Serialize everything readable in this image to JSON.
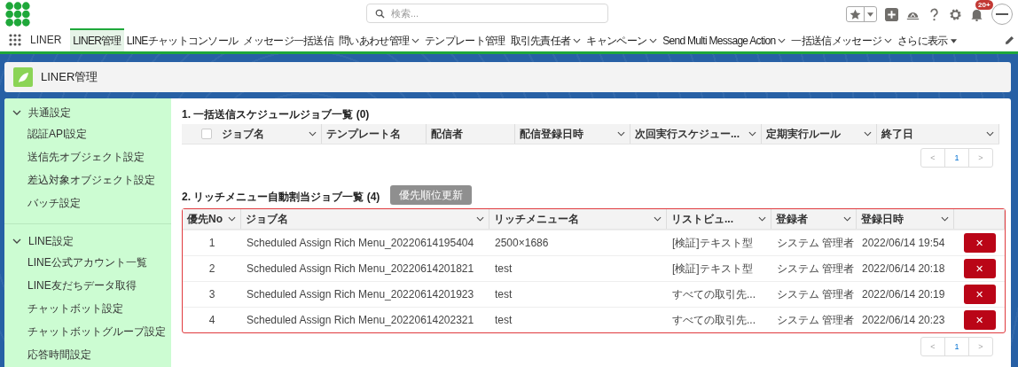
{
  "app": {
    "name": "LINER",
    "search": {
      "placeholder": "検索..."
    },
    "notifications": "20+"
  },
  "nav": [
    {
      "label": "LINER管理",
      "selected": true,
      "kind": "plain"
    },
    {
      "label": "LINEチャットコンソール",
      "selected": false,
      "kind": "plain"
    },
    {
      "label": "メッセージ一括送信",
      "selected": false,
      "kind": "plain"
    },
    {
      "label": "問いあわせ管理",
      "selected": false,
      "kind": "dropdown"
    },
    {
      "label": "テンプレート管理",
      "selected": false,
      "kind": "plain"
    },
    {
      "label": "取引先責任者",
      "selected": false,
      "kind": "dropdown"
    },
    {
      "label": "キャンペーン",
      "selected": false,
      "kind": "dropdown"
    },
    {
      "label": "Send Multi Message Action",
      "selected": false,
      "kind": "dropdown"
    },
    {
      "label": "一括送信メッセージ",
      "selected": false,
      "kind": "dropdown"
    },
    {
      "label": "さらに表示",
      "selected": false,
      "kind": "more"
    }
  ],
  "page_title": "LINER管理",
  "sidebar": [
    {
      "label": "共通設定",
      "expanded": true,
      "children": [
        {
          "label": "認証API設定"
        },
        {
          "label": "送信先オブジェクト設定"
        },
        {
          "label": "差込対象オブジェクト設定"
        },
        {
          "label": "バッチ設定"
        }
      ]
    },
    {
      "label": "LINE設定",
      "expanded": true,
      "children": [
        {
          "label": "LINE公式アカウント一覧"
        },
        {
          "label": "LINE友だちデータ取得"
        },
        {
          "label": "チャットボット設定"
        },
        {
          "label": "チャットボットグループ設定"
        },
        {
          "label": "応答時間設定"
        }
      ]
    }
  ],
  "schedule_table": {
    "title": "1. 一括送信スケジュールジョブ一覧 (0)",
    "select_all": {
      "checked": false
    },
    "columns": [
      {
        "label": "ジョブ名",
        "menu": true
      },
      {
        "label": "テンプレート名",
        "menu": false
      },
      {
        "label": "配信者",
        "menu": false
      },
      {
        "label": "配信登録日時",
        "menu": true
      },
      {
        "label": "次回実行スケジュー...",
        "menu": true
      },
      {
        "label": "定期実行ルール",
        "menu": true
      },
      {
        "label": "終了日",
        "menu": true
      }
    ],
    "pager": {
      "prev": "<",
      "page": "1",
      "next": ">"
    }
  },
  "rich_table": {
    "title": "2. リッチメニュー自動割当ジョブ一覧 (4)",
    "update_button": {
      "label": "優先順位更新",
      "disabled": true
    },
    "columns": [
      {
        "label": "優先No",
        "menu": true
      },
      {
        "label": "ジョブ名",
        "menu": true
      },
      {
        "label": "リッチメニュー名",
        "menu": true
      },
      {
        "label": "リストビュ...",
        "menu": true
      },
      {
        "label": "登録者",
        "menu": true
      },
      {
        "label": "登録日時",
        "menu": true
      }
    ],
    "rows": [
      {
        "no": "1",
        "job": "Scheduled Assign Rich Menu_20220614195404",
        "menu": "2500×1686",
        "view": "[検証]テキスト型",
        "user": "システム 管理者",
        "date": "2022/06/14 19:54",
        "delete": "✕"
      },
      {
        "no": "2",
        "job": "Scheduled Assign Rich Menu_20220614201821",
        "menu": "test",
        "view": "[検証]テキスト型",
        "user": "システム 管理者",
        "date": "2022/06/14 20:18",
        "delete": "✕"
      },
      {
        "no": "3",
        "job": "Scheduled Assign Rich Menu_20220614201923",
        "menu": "test",
        "view": "すべての取引先...",
        "user": "システム 管理者",
        "date": "2022/06/14 20:19",
        "delete": "✕"
      },
      {
        "no": "4",
        "job": "Scheduled Assign Rich Menu_20220614202321",
        "menu": "test",
        "view": "すべての取引先...",
        "user": "システム 管理者",
        "date": "2022/06/14 20:23",
        "delete": "✕"
      }
    ],
    "pager": {
      "prev": "<",
      "page": "1",
      "next": ">"
    }
  }
}
